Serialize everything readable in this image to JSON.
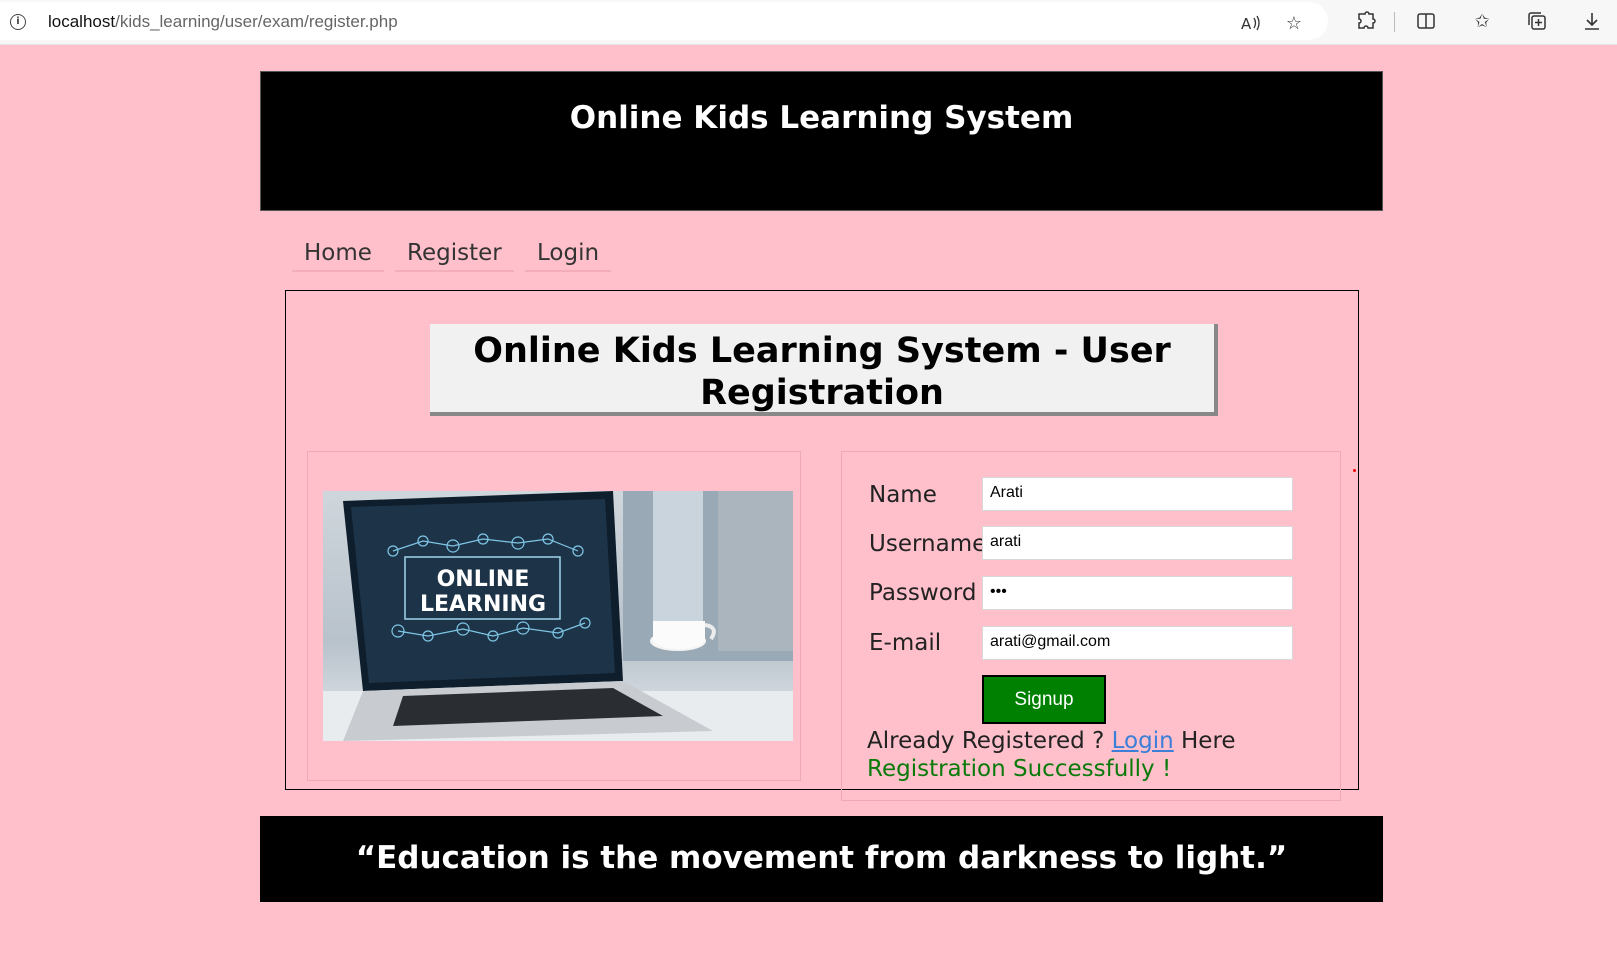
{
  "browser": {
    "url_host": "localhost",
    "url_path": "/kids_learning/user/exam/register.php",
    "icons": [
      "info-icon",
      "read-aloud-icon",
      "favorite-star-icon",
      "extensions-icon",
      "split-screen-icon",
      "favorites-icon",
      "collections-icon",
      "download-icon"
    ]
  },
  "header": {
    "title": "Online Kids Learning System"
  },
  "nav": {
    "items": [
      "Home",
      "Register",
      "Login"
    ]
  },
  "registration": {
    "title": "Online Kids Learning System - User Registration",
    "image_text_line1": "ONLINE",
    "image_text_line2": "LEARNING",
    "form": {
      "name_label": "Name",
      "name_value": "Arati",
      "username_label": "Username",
      "username_value": "arati",
      "password_label": "Password",
      "password_value": "•••",
      "email_label": "E-mail",
      "email_value": "arati@gmail.com",
      "signup_label": "Signup"
    },
    "already_prefix": "Already Registered ? ",
    "login_link": "Login",
    "already_suffix": " Here",
    "success_message": "Registration Successfully !"
  },
  "footer": {
    "quote": "“Education is the movement from darkness to light.”"
  },
  "colors": {
    "page_bg": "#ffc0cb",
    "header_bg": "#000000",
    "button_bg": "#008000",
    "success_text": "#0a7a0a",
    "link": "#3b7fd8"
  }
}
